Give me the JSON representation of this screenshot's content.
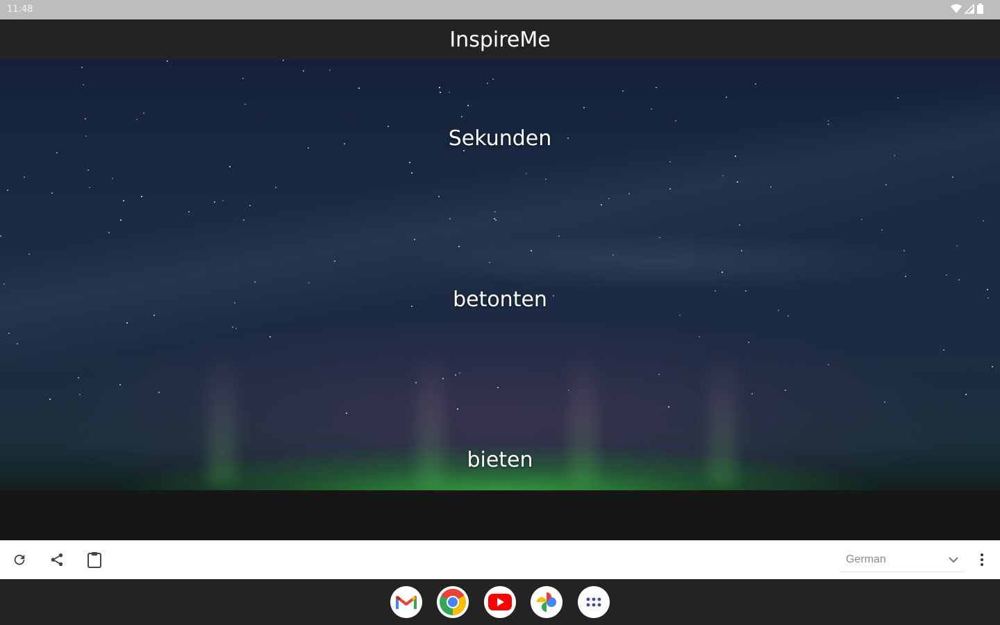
{
  "status_bar": {
    "time": "11:48",
    "icons": [
      "wifi-icon",
      "signal-icon",
      "battery-icon"
    ]
  },
  "app": {
    "title": "InspireMe"
  },
  "words": {
    "first": "Sekunden",
    "second": "betonten",
    "third": "bieten"
  },
  "toolbar": {
    "icons": [
      "refresh-icon",
      "share-icon",
      "clipboard-icon"
    ],
    "language_selected": "German",
    "more_icon": "more-vert-icon"
  },
  "dock": {
    "apps": [
      "gmail-icon",
      "chrome-icon",
      "youtube-icon",
      "photos-icon",
      "app-drawer-icon"
    ]
  },
  "colors": {
    "app_bar": "#232323",
    "toolbar": "#ffffff",
    "text_on_dark": "#ffffff",
    "language_text": "#8a8a8a"
  }
}
